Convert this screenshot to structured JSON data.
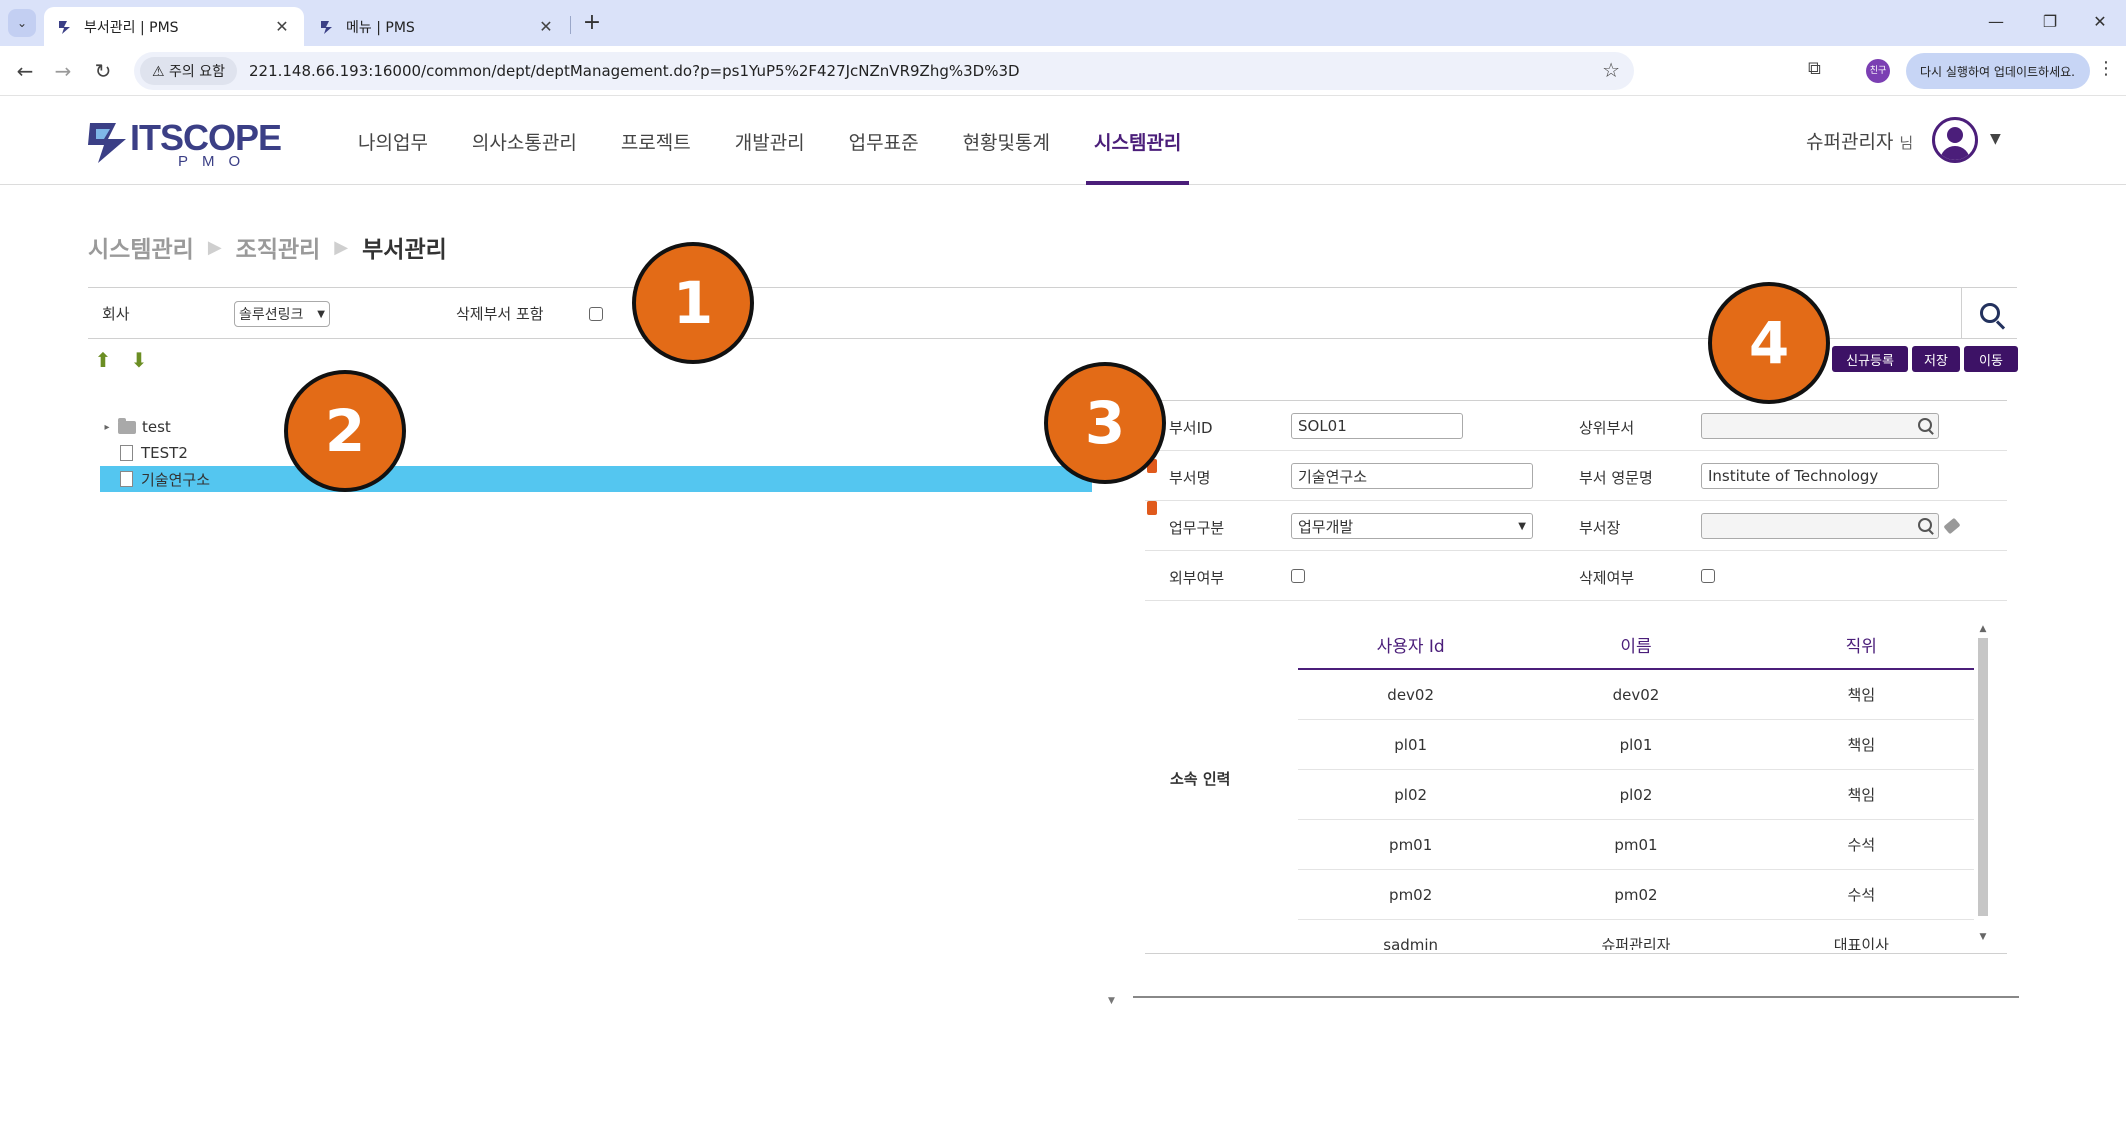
{
  "browser": {
    "tabs": [
      {
        "title": "부서관리 | PMS",
        "active": true
      },
      {
        "title": "메뉴 | PMS",
        "active": false
      }
    ],
    "security_chip": "⚠ 주의 요함",
    "url": "221.148.66.193:16000/common/dept/deptManagement.do?p=ps1YuP5%2F427JcNZnVR9Zhg%3D%3D",
    "profile_badge": "친구",
    "update_text": "다시 실행하여 업데이트하세요."
  },
  "header": {
    "logo_word": "ITSCOPE",
    "logo_sub": "PMO",
    "nav": [
      {
        "label": "나의업무",
        "active": false
      },
      {
        "label": "의사소통관리",
        "active": false
      },
      {
        "label": "프로젝트",
        "active": false
      },
      {
        "label": "개발관리",
        "active": false
      },
      {
        "label": "업무표준",
        "active": false
      },
      {
        "label": "현황및통계",
        "active": false
      },
      {
        "label": "시스템관리",
        "active": true
      }
    ],
    "user_name": "슈퍼관리자",
    "user_suffix": "님"
  },
  "breadcrumb": [
    "시스템관리",
    "조직관리",
    "부서관리"
  ],
  "search": {
    "company_label": "회사",
    "company_value": "솔루션링크",
    "include_deleted_label": "삭제부서 포함"
  },
  "tree": [
    {
      "label": "test",
      "type": "folder"
    },
    {
      "label": "TEST2",
      "type": "file"
    },
    {
      "label": "기술연구소",
      "type": "file",
      "selected": true
    }
  ],
  "actions": {
    "new_label": "신규등록",
    "save_label": "저장",
    "move_label": "이동"
  },
  "form": {
    "dept_id_label": "부서ID",
    "dept_id_value": "SOL01",
    "parent_label": "상위부서",
    "parent_value": "",
    "dept_name_label": "부서명",
    "dept_name_value": "기술연구소",
    "dept_eng_label": "부서 영문명",
    "dept_eng_value": "Institute of Technology",
    "work_type_label": "업무구분",
    "work_type_value": "업무개발",
    "head_label": "부서장",
    "head_value": "",
    "external_label": "외부여부",
    "deleted_label": "삭제여부",
    "members_label": "소속 인력"
  },
  "members": {
    "columns": [
      "사용자 Id",
      "이름",
      "직위"
    ],
    "rows": [
      [
        "dev02",
        "dev02",
        "책임"
      ],
      [
        "pl01",
        "pl01",
        "책임"
      ],
      [
        "pl02",
        "pl02",
        "책임"
      ],
      [
        "pm01",
        "pm01",
        "수석"
      ],
      [
        "pm02",
        "pm02",
        "수석"
      ],
      [
        "sadmin",
        "슈퍼관리자",
        "대표이사"
      ]
    ]
  },
  "markers": [
    "1",
    "2",
    "3",
    "4"
  ],
  "colors": {
    "accent": "#4b1e7a",
    "button": "#3d1266",
    "selected_row": "#54c6f0",
    "marker": "#e36b17"
  }
}
